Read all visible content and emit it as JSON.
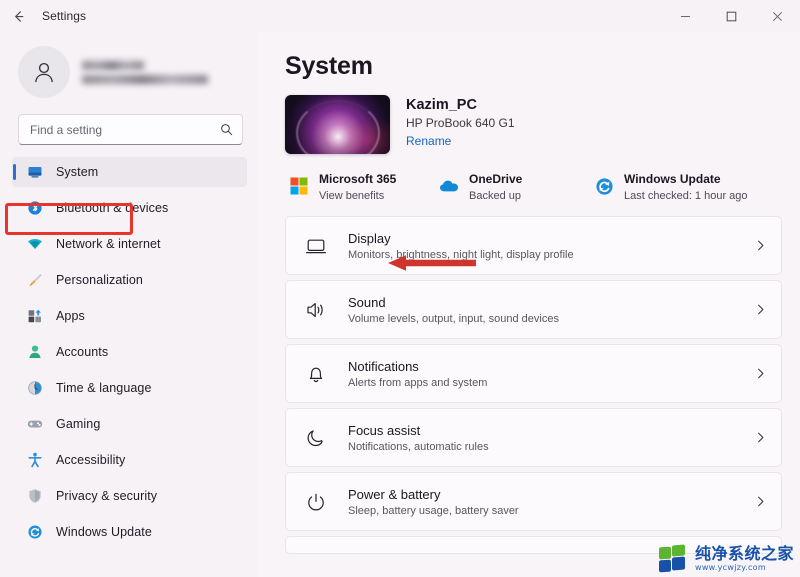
{
  "titlebar": {
    "back_icon": "arrow-left-icon",
    "title": "Settings",
    "minimize_label": "−",
    "maximize_label": "□",
    "close_label": "✕"
  },
  "sidebar": {
    "account": {
      "avatar_icon": "person-avatar-icon",
      "name": "",
      "email": ""
    },
    "search": {
      "placeholder": "Find a setting",
      "value": "",
      "icon": "search-icon"
    },
    "items": [
      {
        "label": "System",
        "icon": "system-monitor-icon",
        "active": true
      },
      {
        "label": "Bluetooth & devices",
        "icon": "bluetooth-icon",
        "active": false
      },
      {
        "label": "Network & internet",
        "icon": "wifi-icon",
        "active": false
      },
      {
        "label": "Personalization",
        "icon": "paintbrush-icon",
        "active": false
      },
      {
        "label": "Apps",
        "icon": "apps-grid-icon",
        "active": false
      },
      {
        "label": "Accounts",
        "icon": "accounts-person-icon",
        "active": false
      },
      {
        "label": "Time & language",
        "icon": "clock-globe-icon",
        "active": false
      },
      {
        "label": "Gaming",
        "icon": "gamepad-icon",
        "active": false
      },
      {
        "label": "Accessibility",
        "icon": "accessibility-person-icon",
        "active": false
      },
      {
        "label": "Privacy & security",
        "icon": "shield-icon",
        "active": false
      },
      {
        "label": "Windows Update",
        "icon": "update-refresh-icon",
        "active": false
      }
    ]
  },
  "main": {
    "page_title": "System",
    "device": {
      "thumbnail_icon": "windows-bloom-wallpaper-thumbnail",
      "name": "Kazim_PC",
      "model": "HP ProBook 640 G1",
      "rename_label": "Rename"
    },
    "quick_links": [
      {
        "title": "Microsoft 365",
        "subtitle": "View benefits",
        "icon": "microsoft-logo-icon"
      },
      {
        "title": "OneDrive",
        "subtitle": "Backed up",
        "icon": "onedrive-cloud-icon"
      },
      {
        "title": "Windows Update",
        "subtitle": "Last checked: 1 hour ago",
        "icon": "update-refresh-icon"
      }
    ],
    "settings_cards": [
      {
        "title": "Display",
        "subtitle": "Monitors, brightness, night light, display profile",
        "icon": "monitor-icon",
        "chevron": "chevron-right-icon"
      },
      {
        "title": "Sound",
        "subtitle": "Volume levels, output, input, sound devices",
        "icon": "speaker-icon",
        "chevron": "chevron-right-icon"
      },
      {
        "title": "Notifications",
        "subtitle": "Alerts from apps and system",
        "icon": "bell-icon",
        "chevron": "chevron-right-icon"
      },
      {
        "title": "Focus assist",
        "subtitle": "Notifications, automatic rules",
        "icon": "moon-icon",
        "chevron": "chevron-right-icon"
      },
      {
        "title": "Power & battery",
        "subtitle": "Sleep, battery usage, battery saver",
        "icon": "power-icon",
        "chevron": "chevron-right-icon"
      }
    ]
  },
  "annotations": {
    "highlight_box_color": "#e8342a",
    "arrow_color": "#cf352c",
    "arrow_target": "Display"
  },
  "watermark": {
    "text": "纯净系统之家",
    "url": "www.ycwjzy.com",
    "logo_icon": "windows-squares-logo-icon",
    "color_blue": "#1851a8",
    "color_green": "#5cb531"
  }
}
